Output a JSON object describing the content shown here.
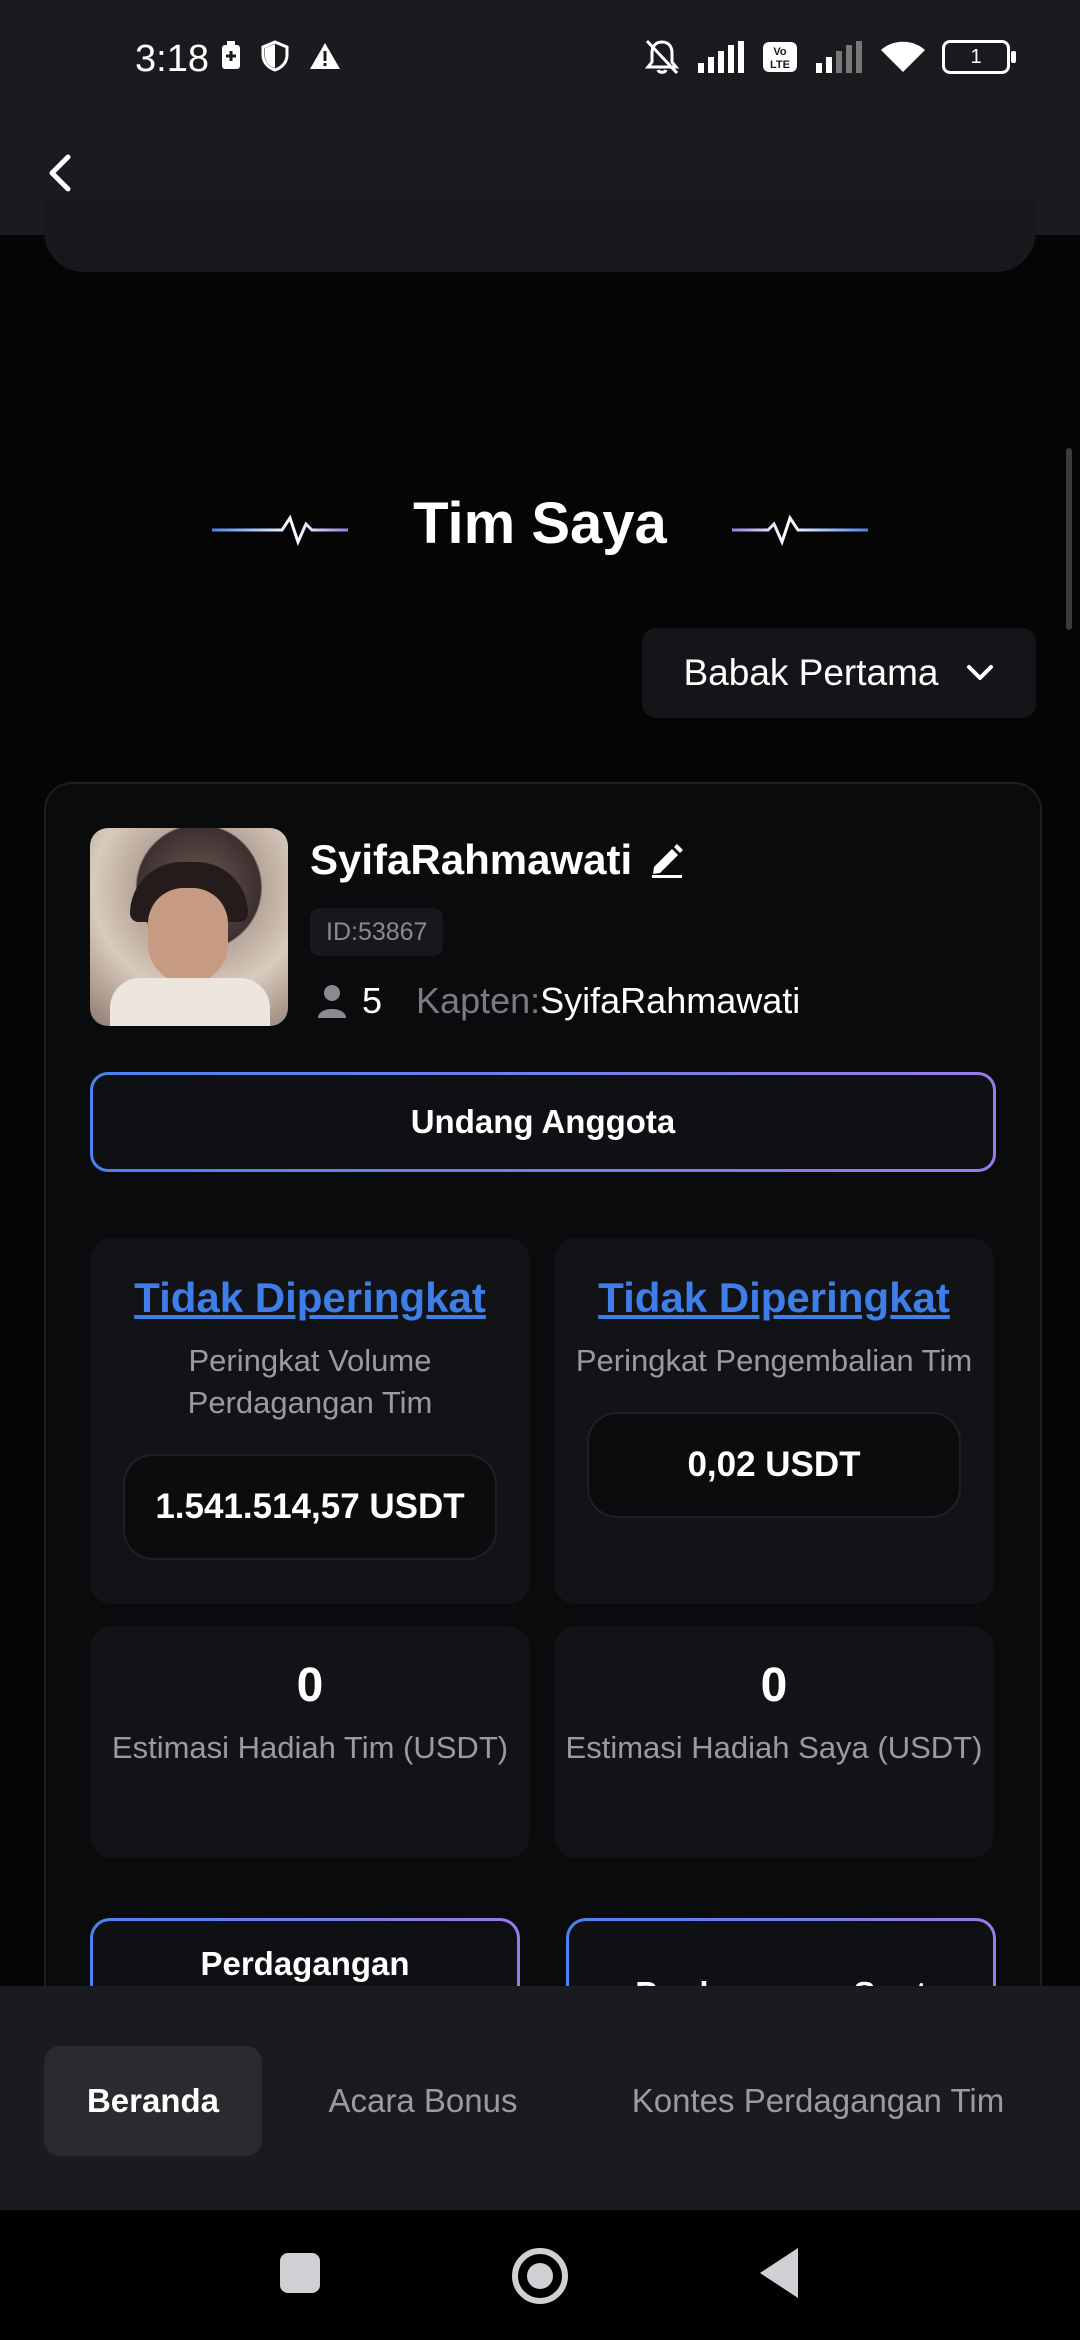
{
  "status_bar": {
    "time": "3:18",
    "battery": "1"
  },
  "section": {
    "title": "Tim Saya"
  },
  "round_select": {
    "value": "Babak Pertama"
  },
  "team": {
    "name": "SyifaRahmawati",
    "id": "ID:53867",
    "member_count": "5",
    "captain_label": "Kapten:",
    "captain_name": "SyifaRahmawati",
    "invite_label": "Undang Anggota"
  },
  "stats": {
    "volume": {
      "rank": "Tidak Diperingkat",
      "desc": "Peringkat Volume Perdagangan Tim",
      "value": "1.541.514,57 USDT"
    },
    "return": {
      "rank": "Tidak Diperingkat",
      "desc": "Peringkat Pengembalian Tim",
      "value": "0,02 USDT"
    },
    "team_reward": {
      "value": "0",
      "desc": "Estimasi Hadiah Tim (USDT)"
    },
    "my_reward": {
      "value": "0",
      "desc": "Estimasi Hadiah Saya (USDT)"
    }
  },
  "actions": {
    "left_label": "Perdagangan",
    "right_label": "Perdagangan Spot"
  },
  "tabs": [
    {
      "label": "Beranda",
      "active": true
    },
    {
      "label": "Acara Bonus",
      "active": false
    },
    {
      "label": "Kontes Perdagangan Tim",
      "active": false
    }
  ]
}
